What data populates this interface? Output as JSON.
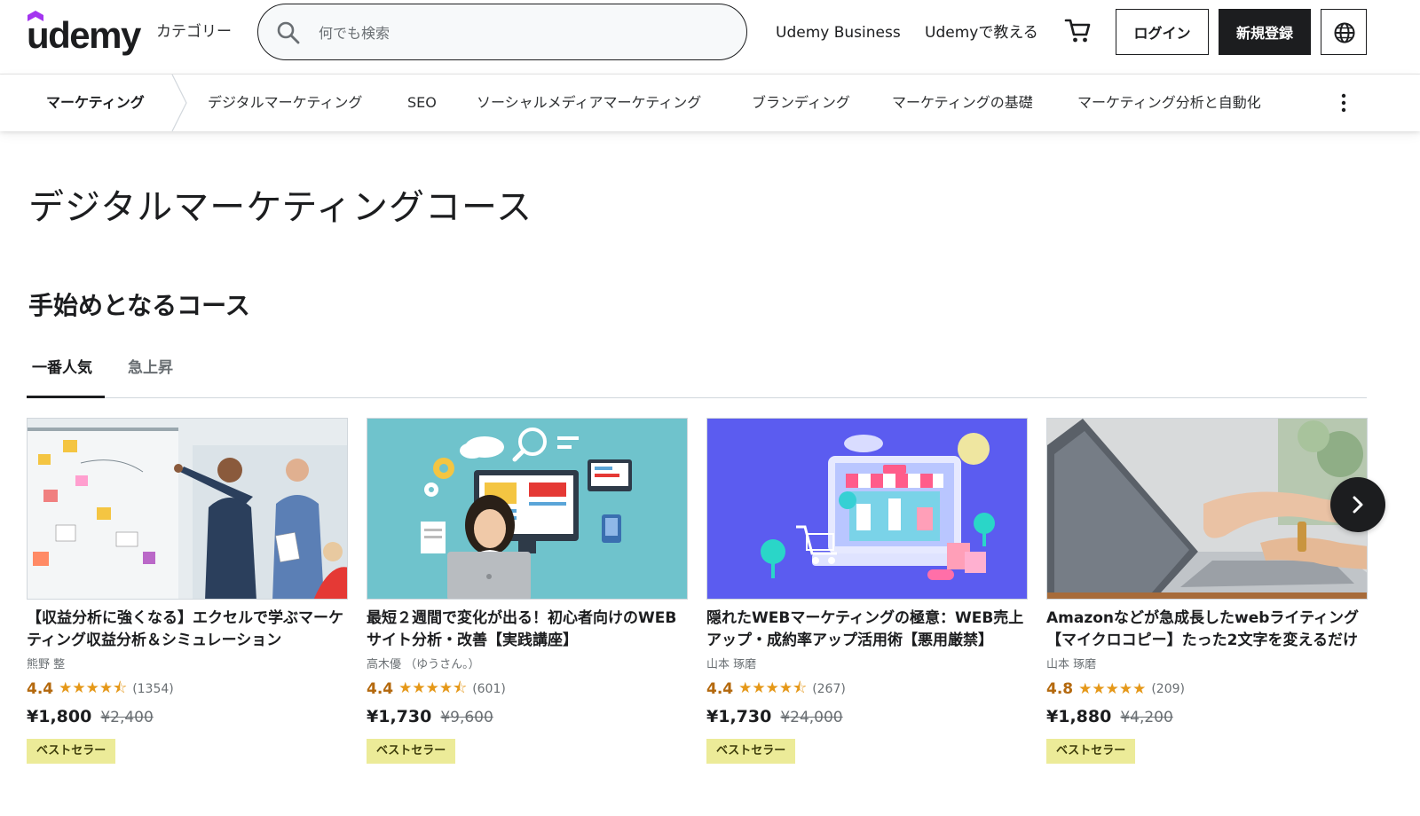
{
  "header": {
    "logo": "udemy",
    "categories": "カテゴリー",
    "search_placeholder": "何でも検索",
    "search_value": "",
    "business": "Udemy Business",
    "teach": "Udemyで教える",
    "login": "ログイン",
    "signup": "新規登録"
  },
  "subnav": {
    "items": [
      {
        "label": "マーケティング"
      },
      {
        "label": "デジタルマーケティング"
      },
      {
        "label": "SEO"
      },
      {
        "label": "ソーシャルメディアマーケティング"
      },
      {
        "label": "ブランディング"
      },
      {
        "label": "マーケティングの基礎"
      },
      {
        "label": "マーケティング分析と自動化"
      }
    ]
  },
  "page": {
    "title": "デジタルマーケティングコース",
    "section_title": "手始めとなるコース",
    "tabs": [
      {
        "label": "一番人気"
      },
      {
        "label": "急上昇"
      }
    ]
  },
  "courses": [
    {
      "title": "【収益分析に強くなる】エクセルで学ぶマーケティング収益分析＆シミュレーション",
      "instructor": "熊野 整",
      "rating": "4.4",
      "stars": "★★★★⯪",
      "reviews": "(1354)",
      "price": "¥1,800",
      "original_price": "¥2,400",
      "badge": "ベストセラー"
    },
    {
      "title": "最短２週間で変化が出る！初心者向けのWEBサイト分析・改善【実践講座】",
      "instructor": "高木優 （ゆうさん。）",
      "rating": "4.4",
      "stars": "★★★★⯪",
      "reviews": "(601)",
      "price": "¥1,730",
      "original_price": "¥9,600",
      "badge": "ベストセラー"
    },
    {
      "title": "隠れたWEBマーケティングの極意：WEB売上アップ・成約率アップ活用術【悪用厳禁】",
      "instructor": "山本 琢磨",
      "rating": "4.4",
      "stars": "★★★★⯪",
      "reviews": "(267)",
      "price": "¥1,730",
      "original_price": "¥24,000",
      "badge": "ベストセラー"
    },
    {
      "title": "Amazonなどが急成長したwebライティング【マイクロコピー】たった2文字を変えるだけ",
      "instructor": "山本 琢磨",
      "rating": "4.8",
      "stars": "★★★★★",
      "reviews": "(209)",
      "price": "¥1,880",
      "original_price": "¥4,200",
      "badge": "ベストセラー"
    }
  ],
  "colors": {
    "brand_purple": "#a435f0",
    "rating_orange": "#b4690e",
    "star_yellow": "#e59819",
    "badge_bg": "#eceb98",
    "dark": "#1c1d1f"
  },
  "icons": {
    "search": "search-icon",
    "cart": "cart-icon",
    "globe": "globe-icon",
    "more": "more-vertical-icon",
    "next": "chevron-right-icon"
  }
}
